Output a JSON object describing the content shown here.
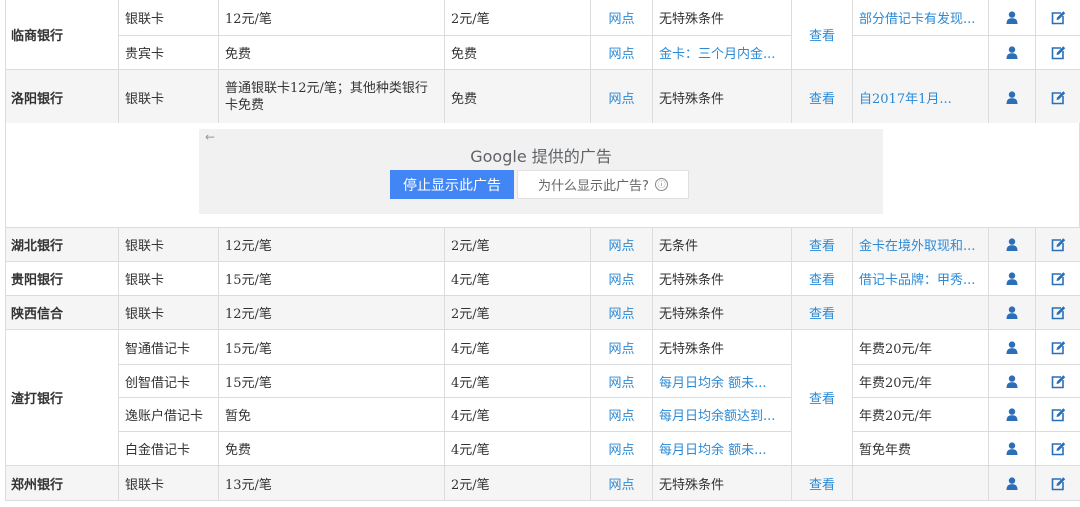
{
  "table_top": {
    "rows": [
      {
        "bank": "临商银行",
        "card": "银联卡",
        "fee1": "12元/笔",
        "fee2": "2元/笔",
        "outlet": "网点",
        "cond": "无特殊条件",
        "view": "查看",
        "note": "部分借记卡有发现..."
      },
      {
        "card": "贵宾卡",
        "fee1": "免费",
        "fee2": "免费",
        "outlet": "网点",
        "cond": "金卡：三个月内金...",
        "note": ""
      },
      {
        "bank": "洛阳银行",
        "card": "银联卡",
        "fee1": "普通银联卡12元/笔；其他种类银行卡免费",
        "fee2": "免费",
        "outlet": "网点",
        "cond": "无特殊条件",
        "view": "查看",
        "note": "自2017年1月..."
      }
    ]
  },
  "ad": {
    "back": "←",
    "title": "Google 提供的广告",
    "stop_label": "停止显示此广告",
    "why_label": "为什么显示此广告?",
    "info_icon": "ⓘ"
  },
  "table_bottom": {
    "rows": [
      {
        "bank": "湖北银行",
        "card": "银联卡",
        "fee1": "12元/笔",
        "fee2": "2元/笔",
        "outlet": "网点",
        "cond": "无条件",
        "view": "查看",
        "note": "金卡在境外取现和..."
      },
      {
        "bank": "贵阳银行",
        "card": "银联卡",
        "fee1": "15元/笔",
        "fee2": "4元/笔",
        "outlet": "网点",
        "cond": "无特殊条件",
        "view": "查看",
        "note": "借记卡品牌：甲秀..."
      },
      {
        "bank": "陕西信合",
        "card": "银联卡",
        "fee1": "12元/笔",
        "fee2": "2元/笔",
        "outlet": "网点",
        "cond": "无特殊条件",
        "view": "查看",
        "note": ""
      },
      {
        "bank": "渣打银行",
        "card": "智通借记卡",
        "fee1": "15元/笔",
        "fee2": "4元/笔",
        "outlet": "网点",
        "cond": "无特殊条件",
        "view": "查看",
        "note": "年费20元/年"
      },
      {
        "card": "创智借记卡",
        "fee1": "15元/笔",
        "fee2": "4元/笔",
        "outlet": "网点",
        "cond": "每月日均余 额未...",
        "note": "年费20元/年"
      },
      {
        "card": "逸账户借记卡",
        "fee1": "暂免",
        "fee2": "4元/笔",
        "outlet": "网点",
        "cond": "每月日均余额达到...",
        "note": "年费20元/年"
      },
      {
        "card": "白金借记卡",
        "fee1": "免费",
        "fee2": "4元/笔",
        "outlet": "网点",
        "cond": "每月日均余 额未...",
        "note": "暂免年费"
      },
      {
        "bank": "郑州银行",
        "card": "银联卡",
        "fee1": "13元/笔",
        "fee2": "2元/笔",
        "outlet": "网点",
        "cond": "无特殊条件",
        "view": "查看",
        "note": ""
      }
    ]
  },
  "colors": {
    "link": "#2b8ad6",
    "icon": "#2b6fb8",
    "ad_button": "#4285f4"
  },
  "icons": {
    "user": "user-icon",
    "edit": "edit-icon"
  }
}
